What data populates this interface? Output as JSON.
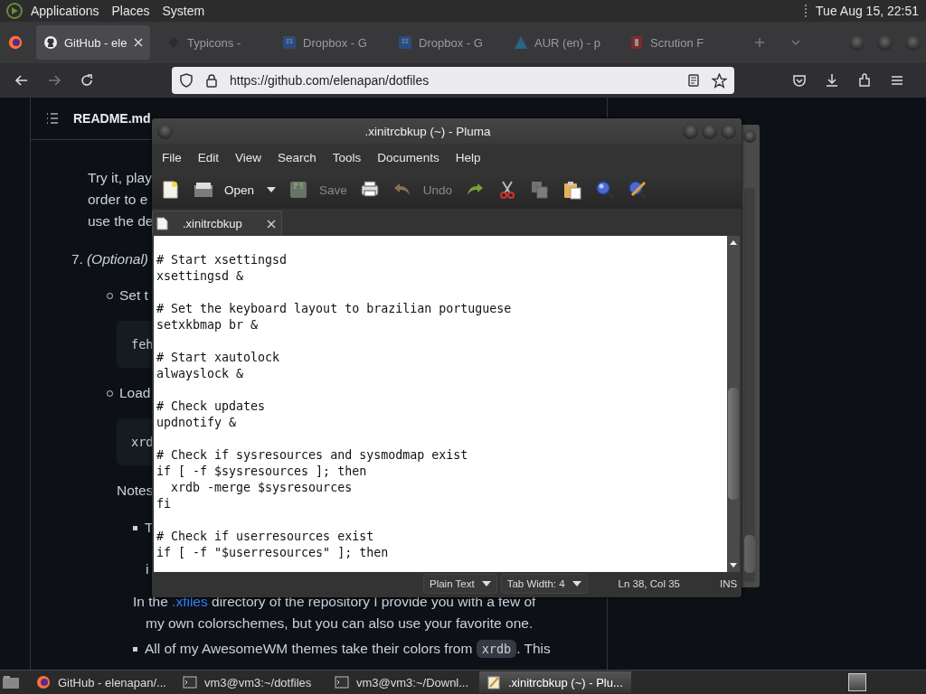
{
  "top_panel": {
    "menus": [
      "Applications",
      "Places",
      "System"
    ],
    "clock": "Tue Aug 15, 22:51"
  },
  "browser": {
    "tabs": [
      {
        "label": "GitHub - ele",
        "selected": true
      },
      {
        "label": "Typicons - ",
        "selected": false
      },
      {
        "label": "Dropbox - G",
        "selected": false
      },
      {
        "label": "Dropbox - G",
        "selected": false
      },
      {
        "label": "AUR (en) - p",
        "selected": false
      },
      {
        "label": "Scrution F",
        "selected": false
      }
    ],
    "url": "https://github.com/elenapan/dotfiles",
    "readme_title": "README.md",
    "lines": [
      {
        "kind": "para_gap",
        "parts": [
          {
            "kind": "text",
            "text": "Try it, play"
          }
        ]
      },
      {
        "kind": "para",
        "parts": [
          {
            "kind": "text",
            "text": "order to e"
          }
        ]
      },
      {
        "kind": "para",
        "parts": [
          {
            "kind": "text",
            "text": "use the de"
          }
        ]
      },
      {
        "kind": "numbered",
        "marker": "7.",
        "parts": [
          {
            "kind": "text",
            "text": "(Optional)"
          }
        ]
      },
      {
        "kind": "circle",
        "parts": [
          {
            "kind": "text",
            "text": "Set t"
          }
        ]
      },
      {
        "kind": "code",
        "parts": [
          {
            "kind": "text",
            "text": "feh"
          }
        ]
      },
      {
        "kind": "circle",
        "parts": [
          {
            "kind": "text",
            "text": "Load"
          }
        ]
      },
      {
        "kind": "code",
        "parts": [
          {
            "kind": "text",
            "text": "xrd"
          }
        ]
      },
      {
        "kind": "note",
        "parts": [
          {
            "kind": "text",
            "text": "Notes"
          }
        ]
      },
      {
        "kind": "square",
        "parts": [
          {
            "kind": "text",
            "text": "T"
          }
        ]
      },
      {
        "kind": "cont_gap",
        "parts": [
          {
            "kind": "text",
            "text": "i"
          }
        ]
      },
      {
        "kind": "square_gap",
        "parts": [
          {
            "kind": "text",
            "text": "In the "
          },
          {
            "kind": "link",
            "text": ".xfiles"
          },
          {
            "kind": "text",
            "text": " directory of the repository I provide you with a few of"
          }
        ]
      },
      {
        "kind": "cont",
        "parts": [
          {
            "kind": "text",
            "text": "my own colorschemes, but you can also use your favorite one."
          }
        ]
      },
      {
        "kind": "square",
        "parts": [
          {
            "kind": "text",
            "text": "All of my AwesomeWM themes take their colors from "
          },
          {
            "kind": "code",
            "text": "xrdb"
          },
          {
            "kind": "text",
            "text": ". This"
          }
        ]
      }
    ]
  },
  "pluma": {
    "title": ".xinitrcbkup (~) - Pluma",
    "menus": [
      "File",
      "Edit",
      "View",
      "Search",
      "Tools",
      "Documents",
      "Help"
    ],
    "toolbar": [
      {
        "kind": "new",
        "disabled": false
      },
      {
        "kind": "open",
        "label": "Open",
        "disabled": false
      },
      {
        "kind": "save",
        "label": "Save",
        "disabled": true
      },
      {
        "kind": "print",
        "disabled": false
      },
      {
        "kind": "undo",
        "label": "Undo",
        "disabled": true
      },
      {
        "kind": "redo",
        "disabled": false
      },
      {
        "kind": "cut",
        "disabled": false
      },
      {
        "kind": "copy",
        "disabled": true
      },
      {
        "kind": "paste",
        "disabled": false
      },
      {
        "kind": "find",
        "disabled": false
      },
      {
        "kind": "replace",
        "disabled": false
      }
    ],
    "tab": ".xinitrcbkup",
    "code": "# Start xsettingsd\nxsettingsd &\n\n# Set the keyboard layout to brazilian portuguese\nsetxkbmap br &\n\n# Start xautolock\nalwayslock &\n\n# Check updates\nupdnotify &\n\n# Check if sysresources and sysmodmap exist\nif [ -f $sysresources ]; then\n  xrdb -merge $sysresources\nfi\n\n# Check if userresources exist\nif [ -f \"$userresources\" ]; then",
    "status": {
      "language": "Plain Text",
      "tab_width": "Tab Width:  4",
      "position": "Ln 38, Col 35",
      "mode": "INS"
    }
  },
  "taskbar": [
    {
      "label": "GitHub - elenapan/...",
      "selected": false
    },
    {
      "label": "vm3@vm3:~/dotfiles",
      "selected": false
    },
    {
      "label": "vm3@vm3:~/Downl...",
      "selected": false
    },
    {
      "label": ".xinitrcbkup (~) - Plu...",
      "selected": true
    }
  ]
}
